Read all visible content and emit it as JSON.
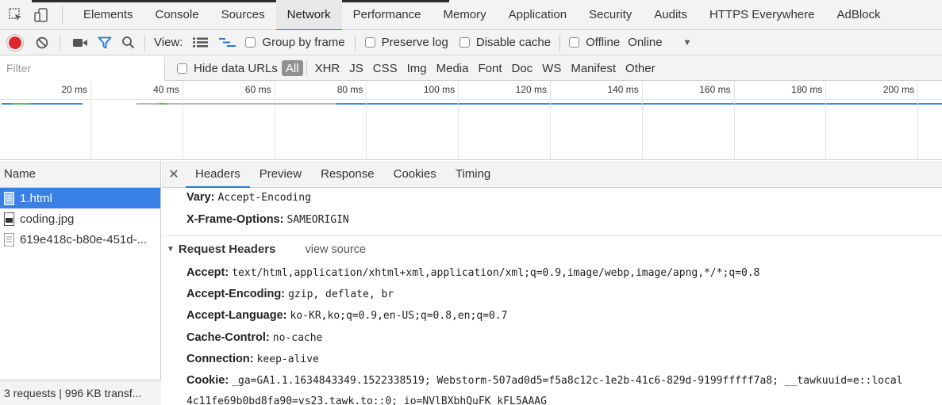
{
  "main_tabs": [
    "Elements",
    "Console",
    "Sources",
    "Network",
    "Performance",
    "Memory",
    "Application",
    "Security",
    "Audits",
    "HTTPS Everywhere",
    "AdBlock"
  ],
  "active_main_tab": "Network",
  "toolbar": {
    "view_label": "View:",
    "group_by_frame": "Group by frame",
    "preserve_log": "Preserve log",
    "disable_cache": "Disable cache",
    "offline": "Offline",
    "throttle_value": "Online"
  },
  "filter": {
    "placeholder": "Filter",
    "hide_data_urls": "Hide data URLs",
    "types": [
      "All",
      "XHR",
      "JS",
      "CSS",
      "Img",
      "Media",
      "Font",
      "Doc",
      "WS",
      "Manifest",
      "Other"
    ],
    "active_type": "All"
  },
  "timeline": {
    "ticks": [
      "20 ms",
      "40 ms",
      "60 ms",
      "80 ms",
      "100 ms",
      "120 ms",
      "140 ms",
      "160 ms",
      "180 ms",
      "200 ms"
    ]
  },
  "requests": {
    "header": "Name",
    "items": [
      {
        "name": "1.html",
        "type": "doc",
        "selected": true
      },
      {
        "name": "coding.jpg",
        "type": "img",
        "selected": false
      },
      {
        "name": "619e418c-b80e-451d-...",
        "type": "doc",
        "selected": false
      }
    ],
    "summary": "3 requests | 996 KB transf..."
  },
  "detail": {
    "tabs": [
      "Headers",
      "Preview",
      "Response",
      "Cookies",
      "Timing"
    ],
    "active_tab": "Headers",
    "response_headers_tail": [
      {
        "key": "Vary:",
        "value": "Accept-Encoding"
      },
      {
        "key": "X-Frame-Options:",
        "value": "SAMEORIGIN"
      }
    ],
    "request_section_title": "Request Headers",
    "view_source": "view source",
    "request_headers": [
      {
        "key": "Accept:",
        "value": "text/html,application/xhtml+xml,application/xml;q=0.9,image/webp,image/apng,*/*;q=0.8"
      },
      {
        "key": "Accept-Encoding:",
        "value": "gzip, deflate, br"
      },
      {
        "key": "Accept-Language:",
        "value": "ko-KR,ko;q=0.9,en-US;q=0.8,en;q=0.7"
      },
      {
        "key": "Cache-Control:",
        "value": "no-cache"
      },
      {
        "key": "Connection:",
        "value": "keep-alive"
      },
      {
        "key": "Cookie:",
        "value": "_ga=GA1.1.1634843349.1522338519; Webstorm-507ad0d5=f5a8c12c-1e2b-41c6-829d-9199fffff7a8; __tawkuuid=e::local"
      }
    ],
    "cookie_continuation": "4c11fe69b0bd8fa90=vs23.tawk.to::0; io=NVlBXbhQuFK_kFL5AAAG"
  },
  "colors": {
    "accent": "#2a76d8",
    "record": "#e0262d",
    "selected_row": "#3880e5"
  }
}
